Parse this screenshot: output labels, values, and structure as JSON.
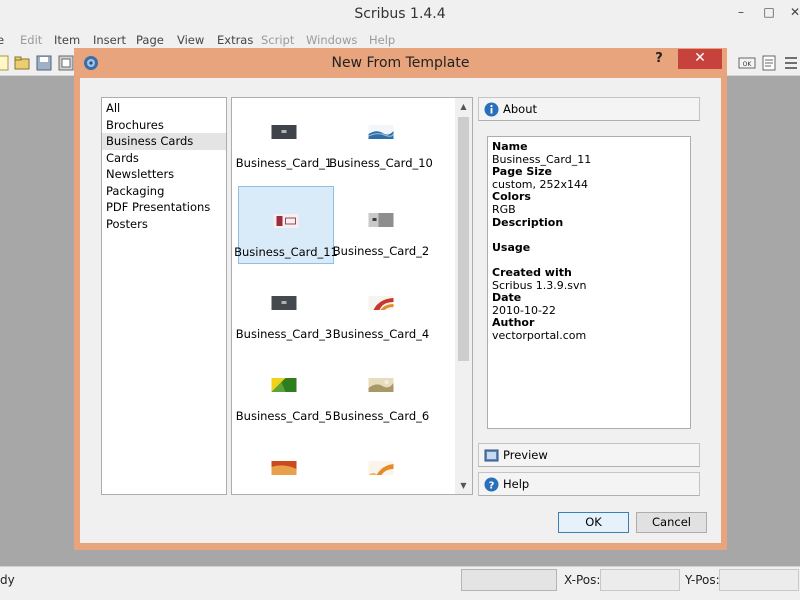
{
  "window": {
    "title": "Scribus 1.4.4",
    "min_glyph": "–",
    "max_glyph": "□",
    "close_glyph": "✕"
  },
  "menubar": {
    "items": [
      {
        "label": "File",
        "visible": "e",
        "enabled": true
      },
      {
        "label": "Edit",
        "enabled": false
      },
      {
        "label": "Item",
        "enabled": true
      },
      {
        "label": "Insert",
        "enabled": true
      },
      {
        "label": "Page",
        "enabled": true
      },
      {
        "label": "View",
        "enabled": true
      },
      {
        "label": "Extras",
        "enabled": true
      },
      {
        "label": "Script",
        "enabled": false
      },
      {
        "label": "Windows",
        "enabled": false
      },
      {
        "label": "Help",
        "enabled": false
      }
    ]
  },
  "dialog": {
    "title": "New From Template",
    "help_glyph": "?",
    "close_glyph": "✕",
    "categories": [
      {
        "label": "All"
      },
      {
        "label": "Brochures"
      },
      {
        "label": "Business Cards",
        "selected": true
      },
      {
        "label": "Cards"
      },
      {
        "label": "Newsletters"
      },
      {
        "label": "Packaging"
      },
      {
        "label": "PDF Presentations"
      },
      {
        "label": "Posters"
      }
    ],
    "templates": [
      {
        "name": "Business_Card_1",
        "thumb": "dark"
      },
      {
        "name": "Business_Card_10",
        "thumb": "wave"
      },
      {
        "name": "Business_Card_11",
        "thumb": "red",
        "selected": true
      },
      {
        "name": "Business_Card_2",
        "thumb": "grey"
      },
      {
        "name": "Business_Card_3",
        "thumb": "dark"
      },
      {
        "name": "Business_Card_4",
        "thumb": "orange"
      },
      {
        "name": "Business_Card_5",
        "thumb": "green"
      },
      {
        "name": "Business_Card_6",
        "thumb": "beige"
      },
      {
        "name": "",
        "thumb": "redorange"
      },
      {
        "name": "",
        "thumb": "orangewave"
      }
    ],
    "scroll_up_glyph": "▲",
    "scroll_down_glyph": "▼",
    "about_label": "About",
    "preview_label": "Preview",
    "help_label": "Help",
    "info": {
      "name_heading": "Name",
      "name_value": "Business_Card_11",
      "page_size_heading": "Page Size",
      "page_size_value": "custom, 252x144",
      "colors_heading": "Colors",
      "colors_value": "RGB",
      "description_heading": "Description",
      "description_value": "",
      "usage_heading": "Usage",
      "usage_value": "",
      "created_with_heading": "Created with",
      "created_with_value": "Scribus 1.3.9.svn",
      "date_heading": "Date",
      "date_value": "2010-10-22",
      "author_heading": "Author",
      "author_value": "vectorportal.com"
    },
    "ok_label": "OK",
    "cancel_label": "Cancel"
  },
  "statusbar": {
    "status_text": "dy",
    "xpos_label": "X-Pos:",
    "ypos_label": "Y-Pos:"
  }
}
